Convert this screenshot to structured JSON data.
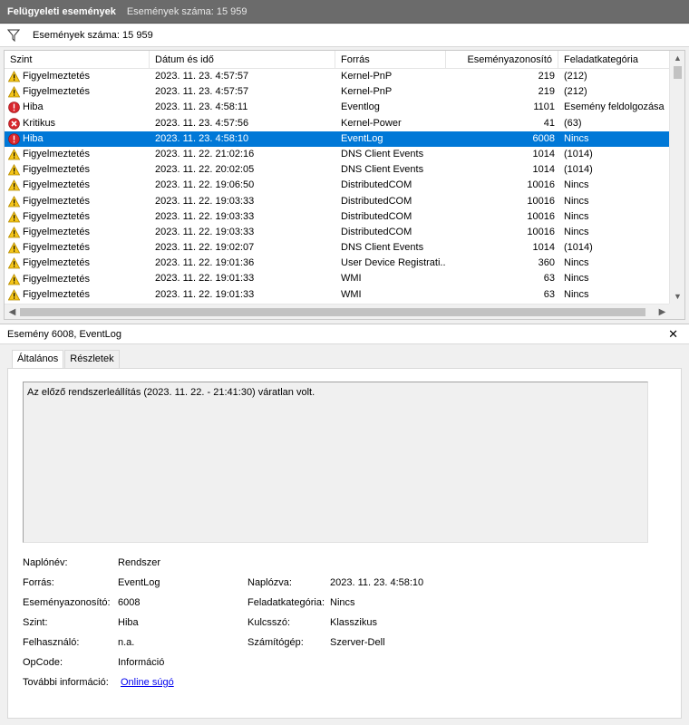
{
  "titlebar": {
    "title": "Felügyeleti események",
    "count_text": "Események száma: 15 959"
  },
  "filterbar": {
    "icon": "filter-icon",
    "count_text": "Események száma: 15 959"
  },
  "grid": {
    "columns": [
      "Szint",
      "Dátum és idő",
      "Forrás",
      "Eseményazonosító",
      "Feladatkategória"
    ],
    "selected_index": 4,
    "rows": [
      {
        "level": "Figyelmeztetés",
        "icon": "warning-icon",
        "date": "2023. 11. 23. 4:57:57",
        "source": "Kernel-PnP",
        "id": "219",
        "category": "(212)"
      },
      {
        "level": "Figyelmeztetés",
        "icon": "warning-icon",
        "date": "2023. 11. 23. 4:57:57",
        "source": "Kernel-PnP",
        "id": "219",
        "category": "(212)"
      },
      {
        "level": "Hiba",
        "icon": "error-icon",
        "date": "2023. 11. 23. 4:58:11",
        "source": "Eventlog",
        "id": "1101",
        "category": "Esemény feldolgozása"
      },
      {
        "level": "Kritikus",
        "icon": "critical-icon",
        "date": "2023. 11. 23. 4:57:56",
        "source": "Kernel-Power",
        "id": "41",
        "category": "(63)"
      },
      {
        "level": "Hiba",
        "icon": "error-icon",
        "date": "2023. 11. 23. 4:58:10",
        "source": "EventLog",
        "id": "6008",
        "category": "Nincs"
      },
      {
        "level": "Figyelmeztetés",
        "icon": "warning-icon",
        "date": "2023. 11. 22. 21:02:16",
        "source": "DNS Client Events",
        "id": "1014",
        "category": "(1014)"
      },
      {
        "level": "Figyelmeztetés",
        "icon": "warning-icon",
        "date": "2023. 11. 22. 20:02:05",
        "source": "DNS Client Events",
        "id": "1014",
        "category": "(1014)"
      },
      {
        "level": "Figyelmeztetés",
        "icon": "warning-icon",
        "date": "2023. 11. 22. 19:06:50",
        "source": "DistributedCOM",
        "id": "10016",
        "category": "Nincs"
      },
      {
        "level": "Figyelmeztetés",
        "icon": "warning-icon",
        "date": "2023. 11. 22. 19:03:33",
        "source": "DistributedCOM",
        "id": "10016",
        "category": "Nincs"
      },
      {
        "level": "Figyelmeztetés",
        "icon": "warning-icon",
        "date": "2023. 11. 22. 19:03:33",
        "source": "DistributedCOM",
        "id": "10016",
        "category": "Nincs"
      },
      {
        "level": "Figyelmeztetés",
        "icon": "warning-icon",
        "date": "2023. 11. 22. 19:03:33",
        "source": "DistributedCOM",
        "id": "10016",
        "category": "Nincs"
      },
      {
        "level": "Figyelmeztetés",
        "icon": "warning-icon",
        "date": "2023. 11. 22. 19:02:07",
        "source": "DNS Client Events",
        "id": "1014",
        "category": "(1014)"
      },
      {
        "level": "Figyelmeztetés",
        "icon": "warning-icon",
        "date": "2023. 11. 22. 19:01:36",
        "source": "User Device Registrati...",
        "id": "360",
        "category": "Nincs"
      },
      {
        "level": "Figyelmeztetés",
        "icon": "warning-icon",
        "date": "2023. 11. 22. 19:01:33",
        "source": "WMI",
        "id": "63",
        "category": "Nincs"
      },
      {
        "level": "Figyelmeztetés",
        "icon": "warning-icon",
        "date": "2023. 11. 22. 19:01:33",
        "source": "WMI",
        "id": "63",
        "category": "Nincs"
      }
    ]
  },
  "detail": {
    "title": "Esemény 6008, EventLog",
    "close_icon": "close-icon",
    "tabs": [
      "Általános",
      "Részletek"
    ],
    "active_tab": 0,
    "description": "Az előző rendszerleállítás (2023. 11. 22. - 21:41:30) váratlan volt.",
    "props": {
      "log_name_label": "Naplónév:",
      "log_name": "Rendszer",
      "source_label": "Forrás:",
      "source": "EventLog",
      "logged_label": "Naplózva:",
      "logged": "2023. 11. 23. 4:58:10",
      "event_id_label": "Eseményazonosító:",
      "event_id": "6008",
      "task_category_label": "Feladatkategória:",
      "task_category": "Nincs",
      "level_label": "Szint:",
      "level": "Hiba",
      "keywords_label": "Kulcsszó:",
      "keywords": "Klasszikus",
      "user_label": "Felhasználó:",
      "user": "n.a.",
      "computer_label": "Számítógép:",
      "computer": "Szerver-Dell",
      "opcode_label": "OpCode:",
      "opcode": "Információ",
      "more_info_label": "További információ:",
      "more_info_link": "Online súgó"
    }
  },
  "colors": {
    "selection": "#0078d7",
    "titlebar": "#6b6b6b",
    "link": "#0000ee"
  }
}
